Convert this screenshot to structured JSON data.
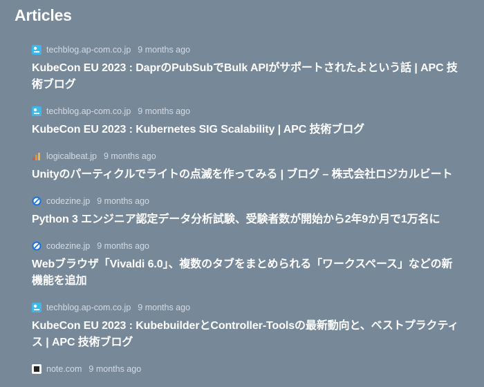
{
  "page": {
    "title": "Articles"
  },
  "articles": [
    {
      "domain": "techblog.ap-com.co.jp",
      "age": "9 months ago",
      "icon": "apc-favicon-icon",
      "title": "KubeCon EU 2023 : DaprのPubSubでBulk APIがサポートされたよという話 | APC 技術ブログ"
    },
    {
      "domain": "techblog.ap-com.co.jp",
      "age": "9 months ago",
      "icon": "apc-favicon-icon",
      "title": "KubeCon EU 2023 : Kubernetes SIG Scalability | APC 技術ブログ"
    },
    {
      "domain": "logicalbeat.jp",
      "age": "9 months ago",
      "icon": "logicalbeat-favicon-icon",
      "title": "Unityのパーティクルでライトの点滅を作ってみる | ブログ – 株式会社ロジカルビート"
    },
    {
      "domain": "codezine.jp",
      "age": "9 months ago",
      "icon": "codezine-favicon-icon",
      "title": "Python 3 エンジニア認定データ分析試験、受験者数が開始から2年9か月で1万名に"
    },
    {
      "domain": "codezine.jp",
      "age": "9 months ago",
      "icon": "codezine-favicon-icon",
      "title": "Webブラウザ「Vivaldi 6.0」、複数のタブをまとめられる「ワークスペース」などの新機能を追加"
    },
    {
      "domain": "techblog.ap-com.co.jp",
      "age": "9 months ago",
      "icon": "apc-favicon-icon",
      "title": "KubeCon EU 2023 : KubebuilderとController-Toolsの最新動向と、ベストプラクティス | APC 技術ブログ"
    },
    {
      "domain": "note.com",
      "age": "9 months ago",
      "icon": "note-favicon-icon",
      "title": ""
    }
  ],
  "colors": {
    "background": "#778899",
    "meta_text": "#d4dce5",
    "title_text": "#ffffff"
  }
}
